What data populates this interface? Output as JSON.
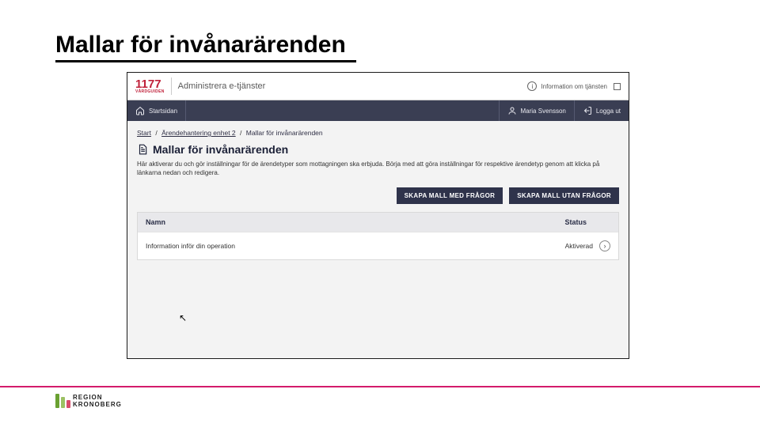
{
  "slide": {
    "title": "Mallar för invånarärenden"
  },
  "header": {
    "logo_main": "1177",
    "logo_sub": "VÅRDGUIDEN",
    "app_name": "Administrera e-tjänster",
    "info_link": "Information om tjänsten"
  },
  "nav": {
    "home": "Startsidan",
    "user": "Maria Svensson",
    "logout": "Logga ut"
  },
  "breadcrumb": {
    "a": "Start",
    "b": "Ärendehantering enhet 2",
    "c": "Mallar för invånarärenden"
  },
  "page": {
    "heading": "Mallar för invånarärenden",
    "intro": "Här aktiverar du och gör inställningar för de ärendetyper som mottagningen ska erbjuda. Börja med att göra inställningar för respektive ärendetyp genom att klicka på länkarna nedan och redigera."
  },
  "buttons": {
    "create_with": "SKAPA MALL MED FRÅGOR",
    "create_without": "SKAPA MALL UTAN FRÅGOR"
  },
  "table": {
    "col_name": "Namn",
    "col_status": "Status",
    "rows": [
      {
        "name": "Information inför din operation",
        "status": "Aktiverad"
      }
    ]
  },
  "footer": {
    "brand_line1": "REGION",
    "brand_line2": "KRONOBERG"
  }
}
